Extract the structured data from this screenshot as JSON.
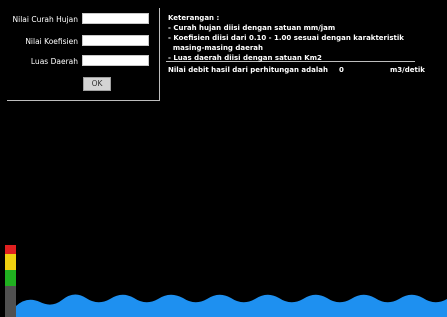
{
  "form": {
    "rainfall_label": "Nilai Curah Hujan",
    "rainfall_value": "",
    "coefficient_label": "Nilai Koefisien",
    "coefficient_value": "",
    "area_label": "Luas Daerah",
    "area_value": "",
    "ok_label": "OK"
  },
  "info": {
    "title": "Keterangan :",
    "lines": [
      "- Curah hujan diisi dengan satuan mm/jam",
      "- Koefisien diisi dari 0.10 - 1.00 sesuai dengan karakteristik",
      "  masing-masing daerah",
      "- Luas daerah diisi dengan satuan Km2"
    ]
  },
  "result": {
    "prefix": "Nilai  debit hasil dari perhitungan adalah",
    "value": "0",
    "unit": "m3/detik"
  },
  "colors": {
    "background": "#000000",
    "water": "#1e90f0",
    "level_red": "#e02020",
    "level_yellow": "#f0d010",
    "level_green": "#20b020",
    "level_gray": "#505050"
  }
}
